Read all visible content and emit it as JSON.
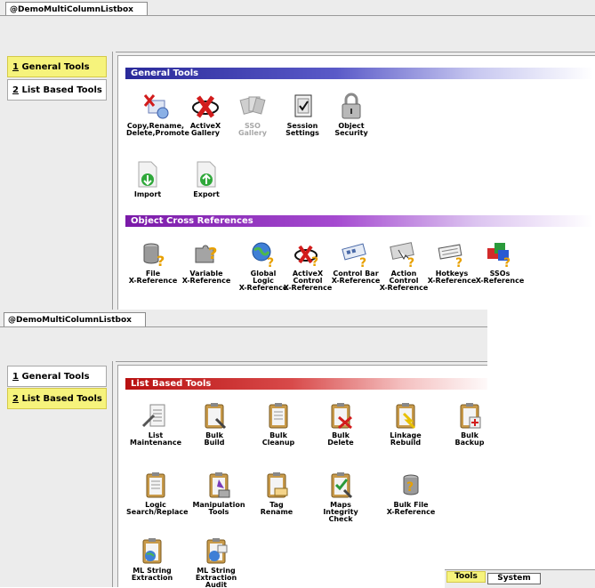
{
  "window_top": {
    "tab_title": "@DemoMultiColumnListbox",
    "nav": [
      {
        "num": "1",
        "label": "General Tools",
        "active": true
      },
      {
        "num": "2",
        "label": "List Based Tools",
        "active": false
      }
    ],
    "section1": "General Tools",
    "section2": "Object Cross References",
    "general_tools": [
      {
        "label": "Copy,Rename,\nDelete,Promote",
        "icon": "copy-rename-icon"
      },
      {
        "label": "ActiveX\nGallery",
        "icon": "activex-icon"
      },
      {
        "label": "SSO\nGallery",
        "icon": "sso-gallery-icon",
        "disabled": true
      },
      {
        "label": "Session\nSettings",
        "icon": "session-settings-icon"
      },
      {
        "label": "Object\nSecurity",
        "icon": "padlock-icon"
      },
      {
        "label": "Import",
        "icon": "import-icon"
      },
      {
        "label": "Export",
        "icon": "export-icon"
      }
    ],
    "xref_tools": [
      {
        "label": "File\nX-Reference",
        "icon": "file-xref-icon"
      },
      {
        "label": "Variable\nX-Reference",
        "icon": "variable-xref-icon"
      },
      {
        "label": "Global\nLogic\nX-Reference",
        "icon": "global-logic-xref-icon"
      },
      {
        "label": "ActiveX\nControl\nX-Reference",
        "icon": "activex-xref-icon"
      },
      {
        "label": "Control Bar\nX-Reference",
        "icon": "control-bar-xref-icon"
      },
      {
        "label": "Action\nControl\nX-Reference",
        "icon": "action-control-xref-icon"
      },
      {
        "label": "Hotkeys\nX-Reference",
        "icon": "hotkeys-xref-icon"
      },
      {
        "label": "SSOs\nX-Reference",
        "icon": "ssos-xref-icon"
      }
    ]
  },
  "window_bottom": {
    "tab_title": "@DemoMultiColumnListbox",
    "nav": [
      {
        "num": "1",
        "label": "General Tools",
        "active": false
      },
      {
        "num": "2",
        "label": "List Based Tools",
        "active": true
      }
    ],
    "section": "List Based Tools",
    "tools": [
      {
        "label": "List\nMaintenance",
        "icon": "list-maintenance-icon"
      },
      {
        "label": "Bulk\nBuild",
        "icon": "bulk-build-icon"
      },
      {
        "label": "Bulk\nCleanup",
        "icon": "bulk-cleanup-icon"
      },
      {
        "label": "Bulk\nDelete",
        "icon": "bulk-delete-icon"
      },
      {
        "label": "Linkage\nRebuild",
        "icon": "linkage-rebuild-icon"
      },
      {
        "label": "Bulk\nBackup",
        "icon": "bulk-backup-icon"
      },
      {
        "label": "Logic\nSearch/Replace",
        "icon": "logic-search-icon"
      },
      {
        "label": "Manipulation\nTools",
        "icon": "manipulation-tools-icon"
      },
      {
        "label": "Tag\nRename",
        "icon": "tag-rename-icon"
      },
      {
        "label": "Maps\nIntegrity\nCheck",
        "icon": "maps-integrity-icon"
      },
      {
        "label": "Bulk File\nX-Reference",
        "icon": "bulk-file-xref-icon"
      },
      {
        "label": "ML String\nExtraction",
        "icon": "ml-string-extraction-icon"
      },
      {
        "label": "ML String\nExtraction\nAudit",
        "icon": "ml-string-audit-icon"
      }
    ],
    "bottom_tabs": [
      "Tools",
      "System"
    ]
  }
}
